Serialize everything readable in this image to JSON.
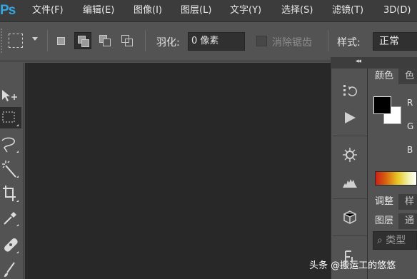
{
  "app": {
    "logo": "Ps"
  },
  "menu": [
    "文件(F)",
    "编辑(E)",
    "图像(I)",
    "图层(L)",
    "文字(Y)",
    "选择(S)",
    "滤镜(T)",
    "3D(D)"
  ],
  "options": {
    "feather_label": "羽化:",
    "feather_value": "0 像素",
    "anti_alias_label": "消除锯齿",
    "style_label": "样式:",
    "style_value": "正常"
  },
  "tools": [
    "move-tool",
    "marquee-tool",
    "lasso-tool",
    "magic-wand-tool",
    "crop-tool",
    "eyedropper-tool",
    "healing-brush-tool",
    "brush-tool"
  ],
  "dock": [
    "history-icon",
    "actions-play-icon",
    "brush-settings-icon",
    "histogram-icon",
    "3d-icon",
    "character-icon"
  ],
  "panels": {
    "color_tab": "颜色",
    "swatches_tab": "色",
    "r_label": "R",
    "g_label": "G",
    "b_label": "B",
    "adjust_tab": "调整",
    "styles_tab": "样",
    "layers_tab": "图层",
    "channels_tab": "通",
    "layer_filter_placeholder": "类型"
  },
  "colors": {
    "foreground": "#000000",
    "background": "#ffffff",
    "logo": "#36a6e3"
  },
  "watermark": "头条 @搬运工的悠悠"
}
